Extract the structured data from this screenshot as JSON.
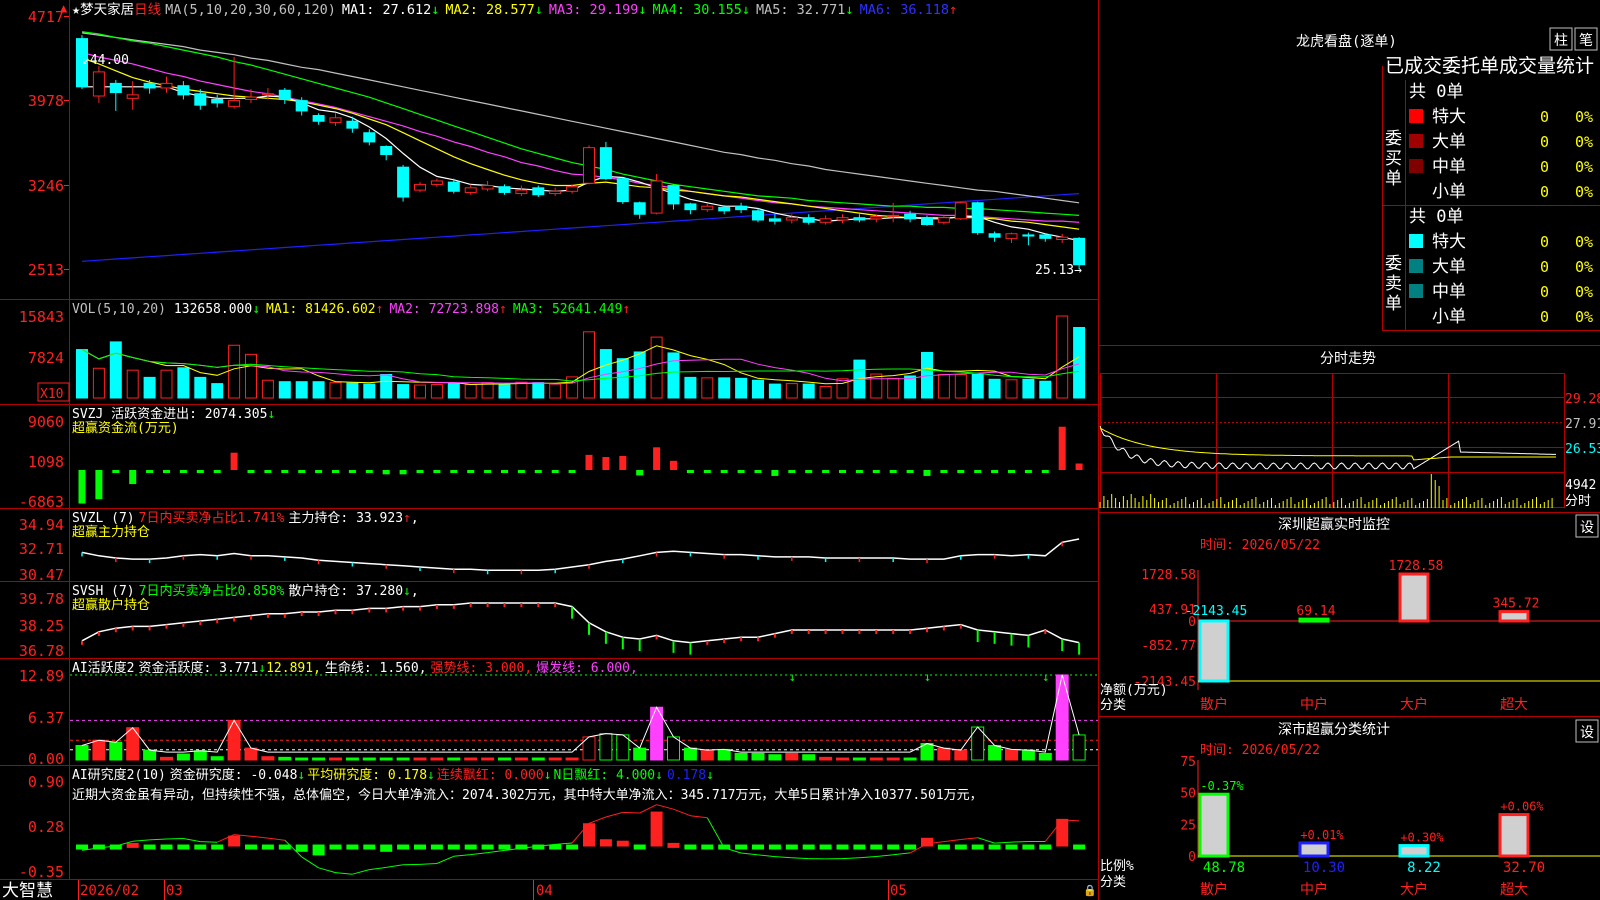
{
  "colors": {
    "up": "#ff2020",
    "down": "#00ffff",
    "grid": "#b00000",
    "yellow": "#ffff00",
    "magenta": "#ff40ff",
    "green": "#00ff00",
    "white": "#ffffff",
    "blue": "#2020ff",
    "gray": "#c0c0c0",
    "cyan": "#00e0ff"
  },
  "header": {
    "star": "★",
    "stock_name": "梦天家居",
    "period": "日线",
    "ma_label": "MA(5,10,20,30,60,120)",
    "ma_values": [
      {
        "label": "MA1: 27.612",
        "arrow": "↓",
        "color": "#ffffff"
      },
      {
        "label": "MA2: 28.577",
        "arrow": "↓",
        "color": "#ffff00"
      },
      {
        "label": "MA3: 29.199",
        "arrow": "↓",
        "color": "#ff40ff"
      },
      {
        "label": "MA4: 30.155",
        "arrow": "↓",
        "color": "#00ff00"
      },
      {
        "label": "MA5: 32.771",
        "arrow": "↓",
        "color": "#c0c0c0"
      },
      {
        "label": "MA6: 36.118",
        "arrow": "↑",
        "color": "#3030ff"
      }
    ]
  },
  "price_axis": [
    "4717",
    "3978",
    "3246",
    "2513"
  ],
  "price_notes": {
    "high": "44.00",
    "low": "25.13"
  },
  "vol_panel": {
    "title": "VOL(5,10,20)",
    "value": "132658.000",
    "arrow": "↓",
    "mas": [
      {
        "label": "MA1: 81426.602",
        "arrow": "↑",
        "color": "#ffff00"
      },
      {
        "label": "MA2: 72723.898",
        "arrow": "↑",
        "color": "#ff40ff"
      },
      {
        "label": "MA3: 52641.449",
        "arrow": "↑",
        "color": "#00ff00"
      }
    ],
    "axis": [
      "15843",
      "7824"
    ],
    "unit": "X10"
  },
  "svzj_panel": {
    "title": "SVZJ  活跃资金进出: 2074.305",
    "arrow": "↓",
    "sub": "超赢资金流(万元)",
    "axis": [
      "9060",
      "1098",
      "-6863"
    ]
  },
  "svzl_panel": {
    "title": "SVZL (7)",
    "pct": "7日内买卖净占比1.741%",
    "hold": "主力持仓: 33.923",
    "arrow": "↑",
    "tail": ",",
    "sub": "超赢主力持仓",
    "axis": [
      "34.94",
      "32.71",
      "30.47"
    ]
  },
  "svsh_panel": {
    "title": "SVSH (7)",
    "pct": "7日内买卖净占比0.858%",
    "hold": "散户持仓: 37.280",
    "arrow": "↓",
    "tail": ",",
    "sub": "超赢散户持仓",
    "axis": [
      "39.78",
      "38.25",
      "36.78"
    ]
  },
  "ai1_panel": {
    "title": "AI活跃度2",
    "t1": "资金活跃度: 3.771",
    "a1": "↓",
    "t2": "12.891,",
    "t3": "生命线: 1.560,",
    "t4": "强势线: 3.000,",
    "t5": "爆发线: 6.000,",
    "axis": [
      "12.89",
      "6.37",
      "0.00"
    ]
  },
  "ai2_panel": {
    "title": "AI研究度2(10)",
    "t1": "资金研究度: -0.048",
    "a1": "↓",
    "t2": "平均研究度: 0.178",
    "a2": "↓",
    "t3": "连续飘红: 0.000",
    "a3": "↓",
    "t4": "N日飘红: 4.000",
    "a4": "↓",
    "t5": "0.178",
    "a5": "↓",
    "comment": "近期大资金虽有异动，但持续性不强，总体偏空，今日大单净流入：2074.302万元，其中特大单净流入：345.717万元，大单5日累计净入10377.501万元，",
    "axis": [
      "0.90",
      "0.28",
      "-0.35"
    ]
  },
  "date_axis": {
    "logo": "大智慧",
    "labels": [
      "2026/02",
      "03",
      "04",
      "05"
    ]
  },
  "right": {
    "title": "龙虎看盘(逐单)",
    "btn1": "柱",
    "btn2": "笔",
    "subtitle": "已成交委托单成交量统计",
    "buy": {
      "side": "委买单",
      "total": "共 0单",
      "rows": [
        {
          "label": "特大",
          "v": "0",
          "p": "0%",
          "color": "#ff0000"
        },
        {
          "label": "大单",
          "v": "0",
          "p": "0%",
          "color": "#a00000"
        },
        {
          "label": "中单",
          "v": "0",
          "p": "0%",
          "color": "#800000"
        },
        {
          "label": "小单",
          "v": "0",
          "p": "0%",
          "color": ""
        }
      ]
    },
    "sell": {
      "side": "委卖单",
      "total": "共 0单",
      "rows": [
        {
          "label": "特大",
          "v": "0",
          "p": "0%",
          "color": "#00ffff"
        },
        {
          "label": "大单",
          "v": "0",
          "p": "0%",
          "color": "#008080"
        },
        {
          "label": "中单",
          "v": "0",
          "p": "0%",
          "color": "#008080"
        },
        {
          "label": "小单",
          "v": "0",
          "p": "0%",
          "color": ""
        }
      ]
    },
    "intraday": {
      "title": "分时走势",
      "axis": [
        "29.28",
        "27.91",
        "26.53"
      ],
      "vol": "4942",
      "vol_unit": "分时"
    },
    "monitor": {
      "title": "深圳超赢实时监控",
      "set": "设",
      "time": "时间: 2026/05/22",
      "axis": [
        "1728.58",
        "437.91",
        "0",
        "-852.77",
        "-2143.45"
      ],
      "unit": "净额(万元)",
      "cls": "分类",
      "cats": [
        "散户",
        "中户",
        "大户",
        "超大"
      ],
      "values": [
        -2143.45,
        69.14,
        1728.58,
        345.72
      ],
      "labels": [
        "-2143.45",
        "69.14",
        "1728.58",
        "345.72"
      ]
    },
    "classify": {
      "title": "深市超赢分类统计",
      "set": "设",
      "time": "时间: 2026/05/22",
      "axis": [
        "75",
        "50",
        "25",
        "0"
      ],
      "unit": "比例%",
      "cls": "分类",
      "cats": [
        "散户",
        "中户",
        "大户",
        "超大"
      ],
      "values": [
        48.78,
        10.3,
        8.22,
        32.7
      ],
      "changes": [
        "-0.37%",
        "+0.01%",
        "+0.30%",
        "+0.06%"
      ]
    }
  },
  "chart_data": {
    "type": "candlestick",
    "ylim": [
      25.13,
      47.17
    ],
    "candles": [
      [
        45.2,
        41.0,
        45.5,
        40.8
      ],
      [
        40.2,
        42.3,
        42.8,
        39.6
      ],
      [
        41.3,
        40.5,
        41.6,
        38.9
      ],
      [
        40.0,
        40.3,
        41.5,
        39.0
      ],
      [
        41.3,
        40.9,
        41.6,
        40.4
      ],
      [
        40.9,
        41.3,
        41.9,
        40.5
      ],
      [
        41.1,
        40.3,
        41.5,
        39.9
      ],
      [
        40.4,
        39.4,
        40.8,
        39.0
      ],
      [
        39.9,
        39.6,
        40.3,
        39.2
      ],
      [
        39.3,
        39.8,
        43.6,
        39.1
      ],
      [
        39.9,
        40.1,
        40.8,
        39.6
      ],
      [
        40.3,
        40.4,
        40.9,
        39.9
      ],
      [
        40.7,
        39.9,
        40.9,
        39.5
      ],
      [
        39.8,
        38.9,
        40.1,
        38.5
      ],
      [
        38.5,
        38.0,
        38.7,
        37.7
      ],
      [
        37.9,
        38.3,
        38.7,
        37.6
      ],
      [
        38.0,
        37.4,
        38.4,
        37.0
      ],
      [
        37.0,
        36.2,
        37.3,
        35.9
      ],
      [
        35.8,
        35.1,
        35.9,
        34.6
      ],
      [
        34.0,
        31.4,
        34.2,
        31.0
      ],
      [
        32.0,
        32.5,
        32.7,
        31.8
      ],
      [
        32.5,
        32.8,
        33.0,
        32.3
      ],
      [
        32.7,
        31.9,
        33.0,
        31.7
      ],
      [
        31.8,
        32.2,
        32.5,
        31.6
      ],
      [
        32.1,
        32.4,
        32.8,
        31.9
      ],
      [
        32.3,
        31.8,
        32.5,
        31.6
      ],
      [
        31.7,
        32.0,
        32.4,
        31.5
      ],
      [
        32.2,
        31.6,
        32.4,
        31.4
      ],
      [
        31.7,
        31.9,
        32.2,
        31.5
      ],
      [
        31.9,
        32.3,
        32.5,
        31.7
      ],
      [
        32.6,
        35.7,
        35.9,
        32.5
      ],
      [
        35.7,
        33.0,
        36.2,
        32.9
      ],
      [
        33.0,
        31.0,
        33.1,
        30.8
      ],
      [
        30.9,
        29.9,
        31.0,
        29.5
      ],
      [
        30.0,
        32.8,
        33.4,
        29.9
      ],
      [
        32.4,
        30.8,
        32.5,
        30.3
      ],
      [
        30.8,
        30.3,
        30.9,
        29.9
      ],
      [
        30.3,
        30.6,
        30.8,
        30.1
      ],
      [
        30.5,
        30.2,
        30.7,
        29.9
      ],
      [
        30.6,
        30.3,
        30.9,
        30.0
      ],
      [
        30.2,
        29.4,
        30.4,
        29.2
      ],
      [
        29.5,
        29.3,
        29.9,
        29.0
      ],
      [
        29.4,
        29.6,
        29.9,
        29.1
      ],
      [
        29.6,
        29.2,
        29.9,
        29.0
      ],
      [
        29.2,
        29.5,
        29.8,
        29.0
      ],
      [
        29.4,
        29.6,
        29.9,
        29.1
      ],
      [
        29.6,
        29.4,
        29.9,
        29.2
      ],
      [
        29.5,
        29.7,
        29.9,
        29.2
      ],
      [
        29.8,
        29.8,
        30.9,
        29.2
      ],
      [
        29.9,
        29.5,
        30.2,
        29.2
      ],
      [
        29.6,
        29.0,
        29.8,
        28.9
      ],
      [
        29.2,
        29.6,
        29.8,
        29.0
      ],
      [
        29.5,
        30.9,
        31.0,
        29.4
      ],
      [
        30.9,
        28.3,
        31.0,
        28.1
      ],
      [
        28.2,
        27.9,
        28.4,
        27.5
      ],
      [
        27.8,
        28.2,
        28.3,
        27.4
      ],
      [
        28.1,
        28.0,
        28.3,
        27.2
      ],
      [
        28.1,
        27.8,
        28.2,
        27.5
      ],
      [
        27.7,
        27.9,
        28.2,
        27.4
      ],
      [
        27.8,
        25.5,
        27.9,
        25.1
      ]
    ],
    "volume": [
      10100,
      6200,
      11700,
      5800,
      4300,
      5800,
      6300,
      4300,
      3000,
      11000,
      9100,
      3700,
      3400,
      3400,
      3400,
      3200,
      3100,
      2900,
      4900,
      2800,
      2700,
      2800,
      3000,
      2800,
      3200,
      2800,
      3300,
      3200,
      2900,
      4400,
      13800,
      10100,
      8200,
      9600,
      12700,
      9400,
      4300,
      4200,
      4200,
      4100,
      3700,
      2900,
      3000,
      2900,
      2400,
      4000,
      7900,
      5000,
      4100,
      4600,
      9500,
      4900,
      4900,
      4900,
      3900,
      3800,
      3900,
      3500,
      17100,
      14700
    ],
    "ma5": [
      41,
      41,
      41,
      41,
      41,
      41,
      40.5,
      40.2,
      40,
      40,
      40,
      40.2,
      40.1,
      39.6,
      39,
      38.8,
      38.3,
      37.5,
      36.5,
      35.2,
      34,
      33.2,
      32.9,
      32.5,
      32.4,
      32.2,
      32.1,
      32,
      31.9,
      32,
      32.7,
      33.2,
      33.1,
      32.7,
      32.2,
      31.7,
      31.2,
      30.9,
      30.6,
      30.6,
      30.4,
      30.0,
      29.7,
      29.5,
      29.3,
      29.4,
      29.5,
      29.5,
      29.6,
      29.6,
      29.5,
      29.5,
      29.7,
      29.7,
      29.2,
      28.8,
      28.6,
      28.2,
      27.9,
      27.6
    ],
    "ma10": [
      43.5,
      43.0,
      42.4,
      41.8,
      41.4,
      41.1,
      40.8,
      40.6,
      40.4,
      40.2,
      40.1,
      40.0,
      39.9,
      39.7,
      39.4,
      39.1,
      38.7,
      38.2,
      37.7,
      37.0,
      36.3,
      35.6,
      34.9,
      34.3,
      33.8,
      33.3,
      32.9,
      32.6,
      32.4,
      32.4,
      32.6,
      32.7,
      32.5,
      32.3,
      32.2,
      32.0,
      31.9,
      31.7,
      31.5,
      31.4,
      31.2,
      31.0,
      30.8,
      30.6,
      30.4,
      30.2,
      30.0,
      29.8,
      29.7,
      29.6,
      29.6,
      29.6,
      29.6,
      29.6,
      29.5,
      29.3,
      29.2,
      29.0,
      28.8,
      28.6
    ],
    "ma20": [
      44.0,
      43.6,
      43.3,
      43.0,
      42.6,
      42.2,
      41.9,
      41.5,
      41.2,
      40.9,
      40.6,
      40.4,
      40.1,
      39.8,
      39.5,
      39.2,
      38.8,
      38.4,
      38.0,
      37.6,
      37.1,
      36.7,
      36.2,
      35.8,
      35.3,
      34.9,
      34.4,
      34.1,
      33.7,
      33.4,
      33.3,
      33.1,
      32.9,
      32.6,
      32.4,
      32.2,
      31.9,
      31.7,
      31.5,
      31.3,
      31.1,
      30.9,
      30.8,
      30.6,
      30.5,
      30.4,
      30.3,
      30.2,
      30.1,
      30.0,
      29.9,
      29.8,
      29.8,
      29.7,
      29.6,
      29.5,
      29.4,
      29.3,
      29.3,
      29.2
    ],
    "ma30": [
      45.8,
      45.6,
      45.3,
      45.0,
      44.8,
      44.5,
      44.2,
      43.9,
      43.6,
      43.2,
      42.9,
      42.5,
      42.1,
      41.7,
      41.3,
      40.9,
      40.5,
      40.1,
      39.6,
      39.1,
      38.6,
      38.1,
      37.6,
      37.1,
      36.6,
      36.1,
      35.6,
      35.2,
      34.8,
      34.4,
      34.1,
      33.8,
      33.4,
      33.1,
      32.8,
      32.5,
      32.3,
      32.1,
      31.9,
      31.7,
      31.5,
      31.4,
      31.3,
      31.1,
      31.0,
      30.9,
      30.8,
      30.7,
      30.6,
      30.6,
      30.5,
      30.5,
      30.4,
      30.4,
      30.3,
      30.2,
      30.1,
      30.0,
      29.9,
      29.8
    ],
    "ma60": [
      45.7,
      45.5,
      45.3,
      45.1,
      44.9,
      44.7,
      44.5,
      44.2,
      44.0,
      43.8,
      43.5,
      43.3,
      43.0,
      42.7,
      42.5,
      42.2,
      41.9,
      41.6,
      41.3,
      41.0,
      40.7,
      40.4,
      40.1,
      39.8,
      39.5,
      39.2,
      38.9,
      38.6,
      38.3,
      38.0,
      37.7,
      37.4,
      37.1,
      36.8,
      36.5,
      36.2,
      35.9,
      35.6,
      35.3,
      35.1,
      34.8,
      34.6,
      34.3,
      34.1,
      33.8,
      33.6,
      33.4,
      33.2,
      33.0,
      32.8,
      32.6,
      32.4,
      32.2,
      32.0,
      31.9,
      31.7,
      31.5,
      31.3,
      31.1,
      30.9
    ],
    "ma120": [
      25.8,
      25.9,
      26.0,
      26.1,
      26.2,
      26.3,
      26.4,
      26.5,
      26.6,
      26.7,
      26.8,
      26.9,
      27.0,
      27.1,
      27.2,
      27.3,
      27.4,
      27.5,
      27.6,
      27.7,
      27.8,
      27.9,
      28.0,
      28.1,
      28.2,
      28.3,
      28.4,
      28.5,
      28.6,
      28.7,
      28.8,
      28.9,
      29.0,
      29.1,
      29.2,
      29.3,
      29.4,
      29.5,
      29.6,
      29.7,
      29.8,
      29.9,
      30.0,
      30.1,
      30.2,
      30.3,
      30.4,
      30.5,
      30.6,
      30.7,
      30.8,
      30.9,
      31.0,
      31.1,
      31.2,
      31.3,
      31.4,
      31.5,
      31.6,
      31.7
    ],
    "svzj": [
      -6200,
      -5400,
      -500,
      -2600,
      -300,
      -300,
      -300,
      -300,
      -300,
      3200,
      -300,
      -300,
      -300,
      -300,
      -300,
      -300,
      -300,
      -300,
      -800,
      -800,
      -300,
      -300,
      -300,
      -300,
      -300,
      -300,
      -300,
      -300,
      -300,
      -300,
      2800,
      2400,
      2600,
      -1000,
      4200,
      1700,
      -300,
      -300,
      -300,
      -300,
      -300,
      -1100,
      -300,
      -300,
      -300,
      -300,
      -300,
      -300,
      -300,
      -300,
      -1100,
      -300,
      -300,
      -300,
      -300,
      -300,
      -300,
      -300,
      8000,
      1200
    ],
    "svzl": [
      32.4,
      32.1,
      31.9,
      31.8,
      31.8,
      31.9,
      32.1,
      32.2,
      32.1,
      32.3,
      32.1,
      32.1,
      32.0,
      31.9,
      31.7,
      31.6,
      31.5,
      31.4,
      31.3,
      31.2,
      31.1,
      31.0,
      30.9,
      30.9,
      30.8,
      30.8,
      30.8,
      30.8,
      30.9,
      31.1,
      31.3,
      31.6,
      31.8,
      32.1,
      32.4,
      32.5,
      32.4,
      32.3,
      32.2,
      32.2,
      32.1,
      32.0,
      32.0,
      32.0,
      31.9,
      31.9,
      31.9,
      31.9,
      31.9,
      31.8,
      31.8,
      31.8,
      32.1,
      32.2,
      32.2,
      32.1,
      32.2,
      32.1,
      33.3,
      33.6
    ],
    "svsh": [
      37.4,
      37.9,
      38.1,
      38.2,
      38.2,
      38.3,
      38.4,
      38.5,
      38.6,
      38.7,
      38.8,
      38.9,
      38.9,
      39.0,
      39.0,
      39.1,
      39.1,
      39.2,
      39.2,
      39.3,
      39.3,
      39.4,
      39.4,
      39.5,
      39.5,
      39.5,
      39.5,
      39.5,
      39.5,
      39.3,
      38.4,
      37.9,
      37.6,
      37.5,
      37.7,
      37.4,
      37.3,
      37.4,
      37.5,
      37.6,
      37.6,
      37.8,
      38.0,
      38.0,
      38.0,
      38.0,
      38.0,
      38.0,
      38.0,
      38.0,
      38.1,
      38.2,
      38.3,
      38.0,
      37.9,
      37.8,
      37.7,
      38.0,
      37.5,
      37.3
    ],
    "ai1": [
      2.2,
      3.0,
      2.7,
      4.9,
      1.5,
      0.4,
      0.9,
      1.4,
      0.5,
      6.0,
      1.8,
      0.5,
      0.4,
      0.3,
      0.3,
      0.3,
      0.3,
      0.3,
      0.3,
      0.3,
      0.3,
      0.3,
      0.3,
      0.3,
      0.3,
      0.3,
      0.3,
      0.3,
      0.3,
      0.3,
      3.5,
      4.0,
      3.8,
      1.8,
      8.0,
      3.5,
      1.8,
      1.5,
      1.6,
      1.0,
      1.0,
      0.8,
      1.0,
      0.8,
      0.4,
      0.3,
      0.3,
      0.3,
      0.3,
      0.3,
      2.5,
      1.8,
      1.5,
      5.0,
      2.2,
      1.6,
      1.5,
      1.0,
      12.9,
      3.8
    ],
    "ai2": [
      0.0,
      0.0,
      0.0,
      0.05,
      0.0,
      0.0,
      0.0,
      0.0,
      0.0,
      0.15,
      0.0,
      0.0,
      0.0,
      -0.1,
      -0.15,
      -0.05,
      0.0,
      0.0,
      -0.1,
      0.0,
      0.0,
      0.0,
      0.0,
      0.0,
      0.0,
      0.0,
      0.0,
      0.0,
      0.0,
      0.0,
      0.32,
      0.1,
      0.08,
      0.0,
      0.48,
      0.05,
      0.0,
      0.0,
      0.0,
      0.0,
      0.0,
      0.0,
      0.0,
      0.0,
      0.0,
      0.0,
      0.0,
      0.0,
      0.0,
      0.0,
      0.12,
      0.0,
      0.0,
      0.0,
      0.0,
      0.0,
      0.0,
      0.0,
      0.38,
      0.0
    ]
  }
}
